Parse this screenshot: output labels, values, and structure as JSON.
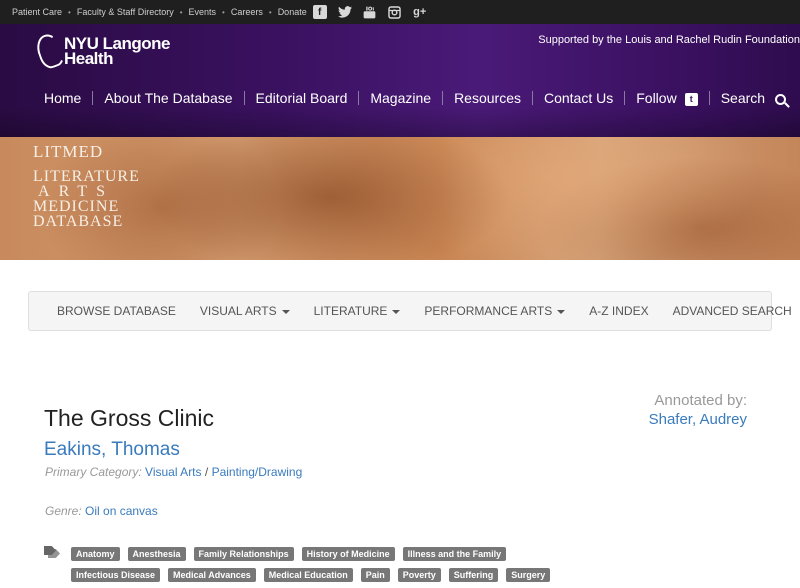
{
  "topbar": {
    "links": [
      "Patient Care",
      "Faculty & Staff Directory",
      "Events",
      "Careers",
      "Donate"
    ],
    "social_icons": [
      "facebook-icon",
      "twitter-icon",
      "youtube-icon",
      "instagram-icon",
      "google-plus-icon"
    ]
  },
  "header": {
    "logo_line1": "NYU Langone",
    "logo_line2": "Health",
    "support_text": "Supported by the Louis and Rachel Rudin Foundation",
    "nav": [
      "Home",
      "About The Database",
      "Editorial Board",
      "Magazine",
      "Resources",
      "Contact Us",
      "Follow",
      "Search"
    ]
  },
  "banner": {
    "line1": "LITMED",
    "line2": "LITERATURE",
    "line3": "ARTS",
    "line4": "MEDICINE",
    "line5": "DATABASE"
  },
  "subnav": {
    "items": [
      "BROWSE DATABASE",
      "VISUAL ARTS",
      "LITERATURE",
      "PERFORMANCE ARTS",
      "A-Z INDEX",
      "ADVANCED SEARCH"
    ]
  },
  "entry": {
    "title": "The Gross Clinic",
    "artist": "Eakins, Thomas",
    "primary_category_label": "Primary Category:",
    "primary_category": "Visual Arts",
    "primary_subcategory": "Painting/Drawing",
    "genre_label": "Genre:",
    "genre": "Oil on canvas",
    "annotated_by_label": "Annotated by:",
    "annotator": "Shafer, Audrey",
    "tags": [
      "Anatomy",
      "Anesthesia",
      "Family Relationships",
      "History of Medicine",
      "Illness and the Family",
      "Infectious Disease",
      "Medical Advances",
      "Medical Education",
      "Pain",
      "Poverty",
      "Suffering",
      "Surgery"
    ]
  },
  "colors": {
    "header_purple": "#3a1160",
    "link_blue": "#3a7bbd",
    "tag_gray": "#777777"
  }
}
